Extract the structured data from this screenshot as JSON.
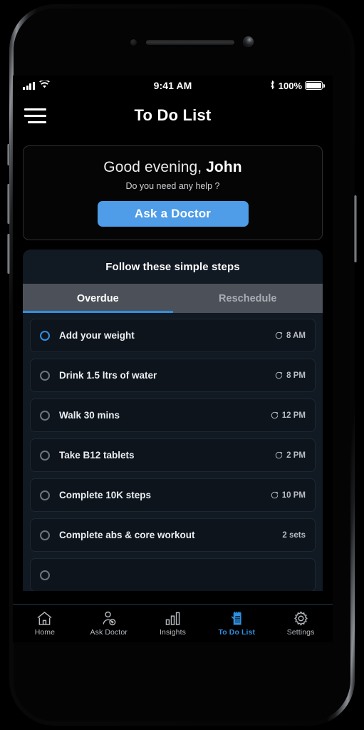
{
  "status_bar": {
    "signal_icon": "cellular-bars-icon",
    "wifi_icon": "wifi-icon",
    "time": "9:41 AM",
    "bluetooth_icon": "bluetooth-icon",
    "battery_percent": "100%",
    "battery_icon": "battery-full-icon"
  },
  "app_bar": {
    "menu_icon": "hamburger-menu-icon",
    "title": "To Do List"
  },
  "greeting_card": {
    "salutation": "Good evening, ",
    "user_name": "John",
    "subtitle": "Do you need any help ?",
    "cta_label": "Ask a Doctor"
  },
  "steps_panel": {
    "heading": "Follow these simple steps",
    "tabs": [
      {
        "label": "Overdue",
        "active": true
      },
      {
        "label": "Reschedule",
        "active": false
      }
    ],
    "tasks": [
      {
        "label": "Add your weight",
        "meta": "8 AM",
        "has_clock": true,
        "selected": true
      },
      {
        "label": "Drink 1.5 ltrs of water",
        "meta": "8 PM",
        "has_clock": true,
        "selected": false
      },
      {
        "label": "Walk 30 mins",
        "meta": "12 PM",
        "has_clock": true,
        "selected": false
      },
      {
        "label": "Take B12 tablets",
        "meta": "2 PM",
        "has_clock": true,
        "selected": false
      },
      {
        "label": "Complete 10K steps",
        "meta": "10 PM",
        "has_clock": true,
        "selected": false
      },
      {
        "label": "Complete abs & core workout",
        "meta": "2 sets",
        "has_clock": false,
        "selected": false
      },
      {
        "label": "",
        "meta": "",
        "has_clock": false,
        "selected": false
      }
    ]
  },
  "bottom_nav": [
    {
      "label": "Home",
      "icon": "home-icon",
      "active": false
    },
    {
      "label": "Ask Doctor",
      "icon": "doctor-icon",
      "active": false
    },
    {
      "label": "Insights",
      "icon": "bar-chart-icon",
      "active": false
    },
    {
      "label": "To Do List",
      "icon": "checklist-icon",
      "active": true
    },
    {
      "label": "Settings",
      "icon": "gear-icon",
      "active": false
    }
  ],
  "colors": {
    "accent_blue": "#2f8fe0",
    "button_blue": "#4f9ce8",
    "panel_bg": "#111923",
    "task_bg": "#0d141c",
    "tab_bar_bg": "#4c5159",
    "screen_bg": "#000000"
  }
}
